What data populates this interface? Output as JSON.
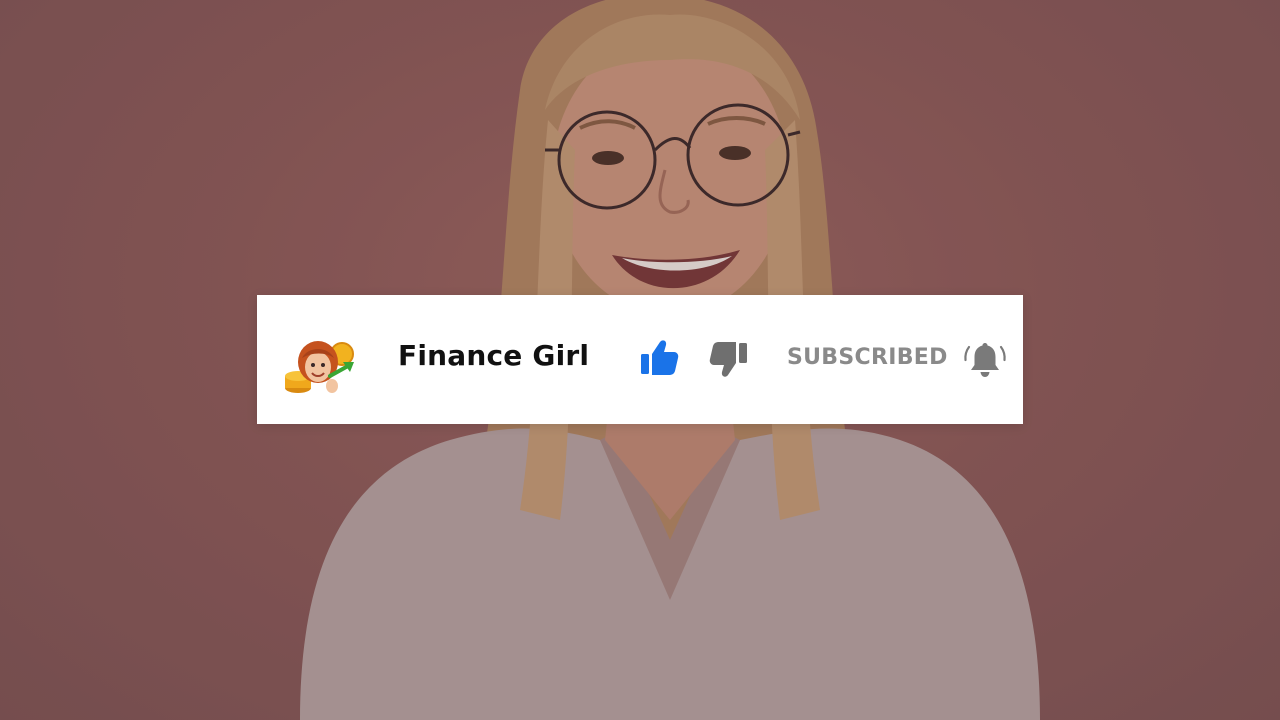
{
  "channel": {
    "name": "Finance Girl",
    "avatar_icon": "cartoon-girl-with-coins-avatar"
  },
  "actions": {
    "like_icon": "thumbs-up-icon",
    "like_color": "#1a73e8",
    "dislike_icon": "thumbs-down-icon",
    "dislike_color": "#6f6f6f",
    "subscribe_label": "SUBSCRIBED",
    "subscribe_color": "#8a8a8a",
    "bell_icon": "notification-bell-icon",
    "bell_color": "#7a7a7a"
  },
  "background": {
    "tint": "#8a5b5b"
  }
}
